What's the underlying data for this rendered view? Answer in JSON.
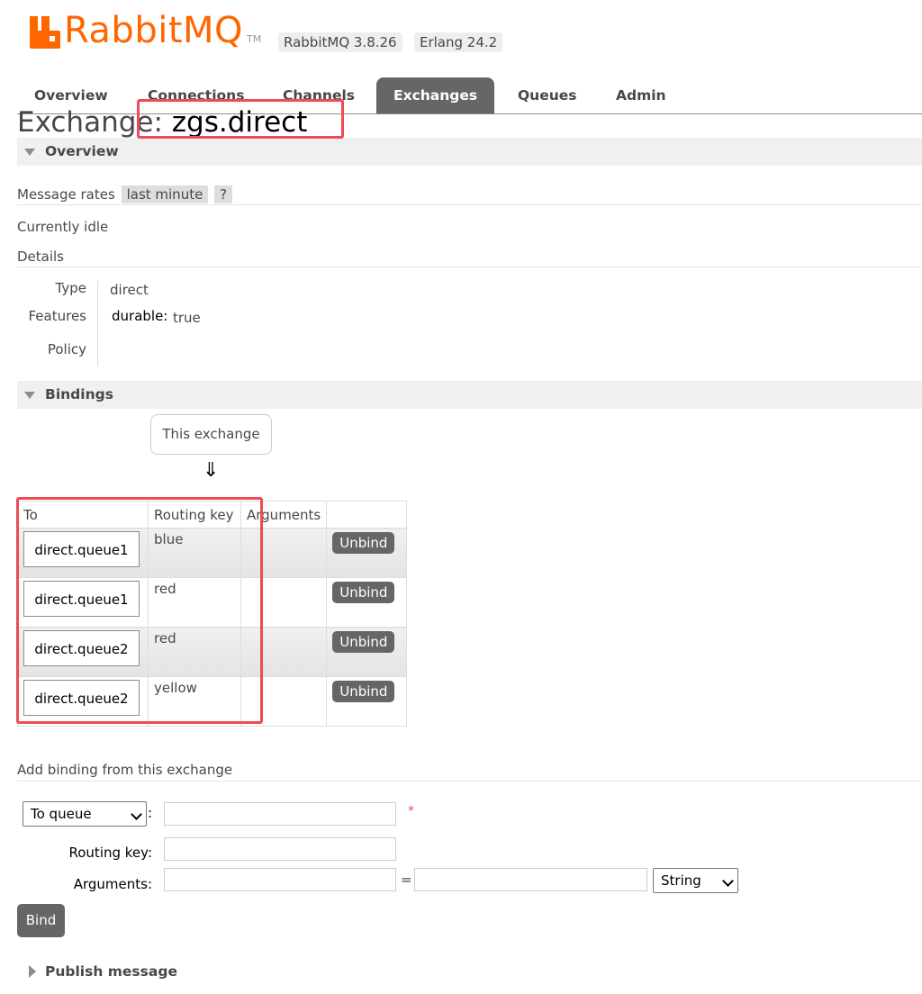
{
  "header": {
    "logo_text": "RabbitMQ",
    "trademark": "TM",
    "version_badge": "RabbitMQ 3.8.26",
    "erlang_badge": "Erlang 24.2",
    "brand_color": "#ff6600"
  },
  "nav": {
    "tabs": [
      {
        "label": "Overview"
      },
      {
        "label": "Connections"
      },
      {
        "label": "Channels"
      },
      {
        "label": "Exchanges"
      },
      {
        "label": "Queues"
      },
      {
        "label": "Admin"
      }
    ],
    "active": "Exchanges"
  },
  "title": {
    "prefix": "Exchange: ",
    "name": "zgs.direct"
  },
  "overview": {
    "section_label": "Overview",
    "message_rates_label": "Message rates",
    "rate_period": "last minute",
    "help": "?",
    "idle_text": "Currently idle",
    "details_label": "Details",
    "type_label": "Type",
    "type_value": "direct",
    "features_label": "Features",
    "durable_label": "durable:",
    "durable_value": "true",
    "policy_label": "Policy"
  },
  "bindings": {
    "section_label": "Bindings",
    "source_box": "This exchange",
    "arrow": "⇓",
    "columns": [
      "To",
      "Routing key",
      "Arguments",
      ""
    ],
    "rows": [
      {
        "to": "direct.queue1",
        "routing_key": "blue",
        "arguments": "",
        "action": "Unbind"
      },
      {
        "to": "direct.queue1",
        "routing_key": "red",
        "arguments": "",
        "action": "Unbind"
      },
      {
        "to": "direct.queue2",
        "routing_key": "red",
        "arguments": "",
        "action": "Unbind"
      },
      {
        "to": "direct.queue2",
        "routing_key": "yellow",
        "arguments": "",
        "action": "Unbind"
      }
    ]
  },
  "add_binding": {
    "heading": "Add binding from this exchange",
    "destination_type": "To queue",
    "colon": ":",
    "required_mark": "*",
    "routing_key_label": "Routing key:",
    "arguments_label": "Arguments:",
    "equals": "=",
    "arg_type": "String",
    "bind_button": "Bind"
  },
  "publish": {
    "label": "Publish message"
  },
  "annotation_color": "#ef4a58"
}
